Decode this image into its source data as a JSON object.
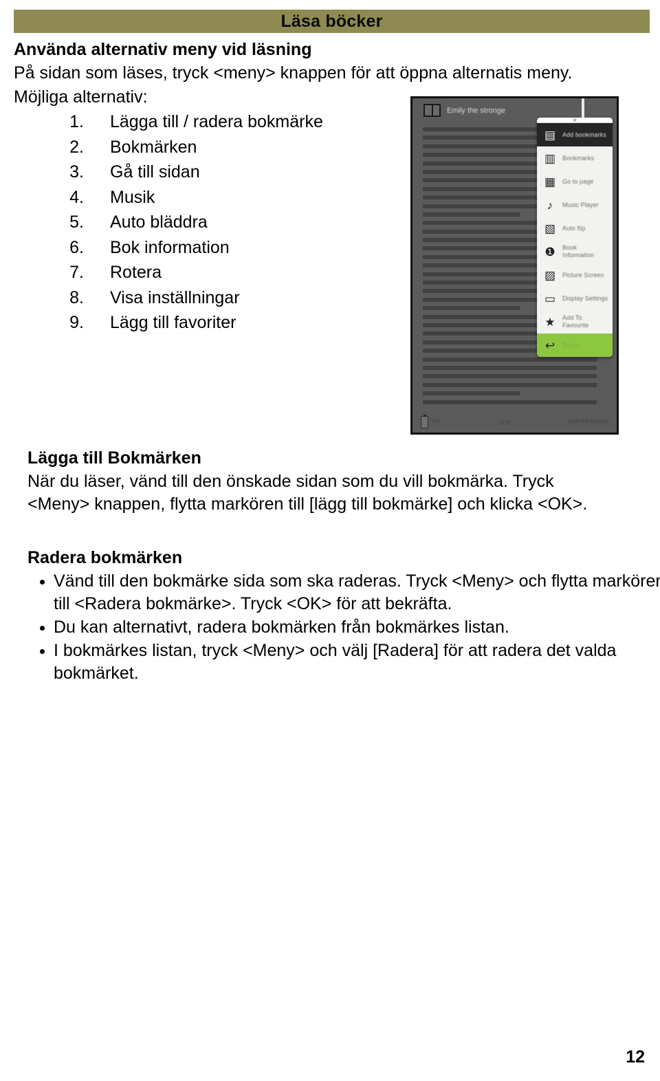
{
  "header": {
    "title": "Läsa böcker",
    "bar_color": "#8e8a52"
  },
  "intro": {
    "heading": "Använda alternativ meny vid läsning",
    "line": "På sidan som läses, tryck <meny> knappen för att öppna alternatis meny.",
    "options_label": "Möjliga alternativ:"
  },
  "options": [
    {
      "num": "1.",
      "label": "Lägga till / radera bokmärke"
    },
    {
      "num": "2.",
      "label": "Bokmärken"
    },
    {
      "num": "3.",
      "label": "Gå till sidan"
    },
    {
      "num": "4.",
      "label": "Musik"
    },
    {
      "num": "5.",
      "label": "Auto bläddra"
    },
    {
      "num": "6.",
      "label": "Bok information"
    },
    {
      "num": "7.",
      "label": "Rotera"
    },
    {
      "num": "8.",
      "label": "Visa inställningar"
    },
    {
      "num": "9.",
      "label": "Lägg till favoriter"
    }
  ],
  "device": {
    "book_title": "Emily the stronge",
    "status_center": "12/30",
    "status_battery": "77%",
    "status_time": "18:05 PM 05/12/13",
    "menu": [
      {
        "label": "Add bookmarks",
        "icon": "add-bookmark-icon",
        "glyph": "▤",
        "selected": true
      },
      {
        "label": "Bookmarks",
        "icon": "bookmarks-icon",
        "glyph": "▥",
        "selected": false
      },
      {
        "label": "Go to page",
        "icon": "go-to-page-icon",
        "glyph": "▦",
        "selected": false
      },
      {
        "label": "Music Player",
        "icon": "music-player-icon",
        "glyph": "♪",
        "selected": false
      },
      {
        "label": "Auto flip",
        "icon": "auto-flip-icon",
        "glyph": "▧",
        "selected": false
      },
      {
        "label": "Book Information",
        "icon": "book-information-icon",
        "glyph": "❶",
        "selected": false
      },
      {
        "label": "Picture Screen",
        "icon": "picture-screen-icon",
        "glyph": "▨",
        "selected": false
      },
      {
        "label": "Display Settings",
        "icon": "display-settings-icon",
        "glyph": "▭",
        "selected": false
      },
      {
        "label": "Add To Favourite",
        "icon": "add-to-favourite-icon",
        "glyph": "★",
        "selected": false
      },
      {
        "label": "Return",
        "icon": "return-icon",
        "glyph": "↩",
        "selected": false,
        "return": true
      }
    ]
  },
  "add_bookmark_section": {
    "heading": "Lägga till Bokmärken",
    "line1": "När du läser, vänd till den önskade sidan som du vill bokmärka. Tryck",
    "line2": "<Meny> knappen, flytta markören till [lägg till bokmärke] och klicka <OK>."
  },
  "delete_bookmark_section": {
    "heading": "Radera bokmärken",
    "bullets": [
      "Vänd till den bokmärke sida som ska raderas. Tryck <Meny> och flytta markören till <Radera bokmärke>. Tryck <OK> för att bekräfta.",
      "Du kan alternativt, radera bokmärken från bokmärkes listan.",
      "I bokmärkes listan, tryck <Meny> och välj [Radera] för att radera det valda bokmärket."
    ]
  },
  "footer": {
    "page_number": "12"
  }
}
